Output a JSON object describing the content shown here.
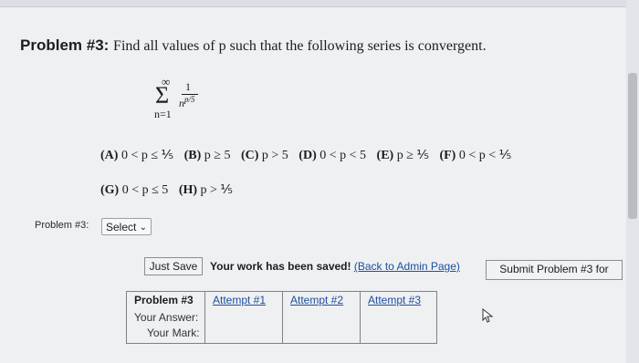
{
  "problem": {
    "title": "Problem #3:",
    "prompt_text": "Find all values of p such that the following series is convergent.",
    "series": {
      "upper": "∞",
      "sigma": "Σ",
      "lower": "n=1",
      "numerator": "1",
      "denominator_base": "n",
      "denominator_exp": "p/5"
    },
    "choices": [
      {
        "label": "(A)",
        "text": "0 < p ≤ ⅕"
      },
      {
        "label": "(B)",
        "text": "p ≥ 5"
      },
      {
        "label": "(C)",
        "text": "p > 5"
      },
      {
        "label": "(D)",
        "text": "0 < p < 5"
      },
      {
        "label": "(E)",
        "text": "p ≥ ⅕"
      },
      {
        "label": "(F)",
        "text": "0 < p < ⅕"
      },
      {
        "label": "(G)",
        "text": "0 < p ≤ 5"
      },
      {
        "label": "(H)",
        "text": "p > ⅕"
      }
    ]
  },
  "answer": {
    "label": "Problem #3:",
    "select_value": "Select",
    "select_arrow": "⌄"
  },
  "actions": {
    "just_save": "Just Save",
    "saved_message": "Your work has been saved!",
    "back_link": "(Back to Admin Page)",
    "submit": "Submit Problem #3 for"
  },
  "attempts": {
    "header": "Problem #3",
    "columns": [
      "Attempt #1",
      "Attempt #2",
      "Attempt #3"
    ],
    "rows": [
      "Your Answer:",
      "Your Mark:"
    ]
  }
}
